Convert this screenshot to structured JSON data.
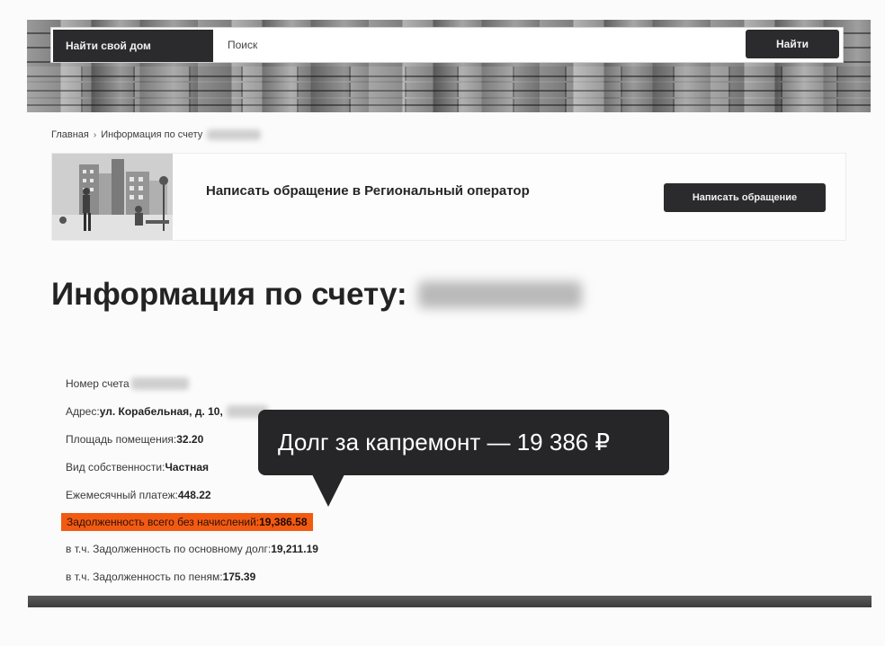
{
  "header": {
    "brand_label": "Найти свой дом",
    "search_placeholder": "Поиск",
    "search_button_label": "Найти"
  },
  "breadcrumb": {
    "home": "Главная",
    "separator": "›",
    "current": "Информация по счету"
  },
  "appeal": {
    "title": "Написать обращение в Региональный оператор",
    "button_label": "Написать обращение"
  },
  "page_title": "Информация по счету:",
  "account": {
    "number_label": "Номер счета",
    "address_label": "Адрес:",
    "address_value": "ул. Корабельная, д. 10,",
    "area_label": "Площадь помещения:",
    "area_value": "32.20",
    "ownership_label": "Вид собственности:",
    "ownership_value": "Частная",
    "monthly_label": "Ежемесячный платеж:",
    "monthly_value": "448.22",
    "debt_total_label": "Задолженность всего без начислений:",
    "debt_total_value": "19,386.58",
    "debt_main_label": "в т.ч. Задолженность по основному долг:",
    "debt_main_value": "19,211.19",
    "debt_penalty_label": "в т.ч. Задолженность по пеням:",
    "debt_penalty_value": "175.39"
  },
  "callout": {
    "text": "Долг за капремонт — 19 386 ₽"
  },
  "colors": {
    "dark_button": "#2b2b2d",
    "highlight": "#f25a12",
    "callout_bg": "#262628"
  }
}
